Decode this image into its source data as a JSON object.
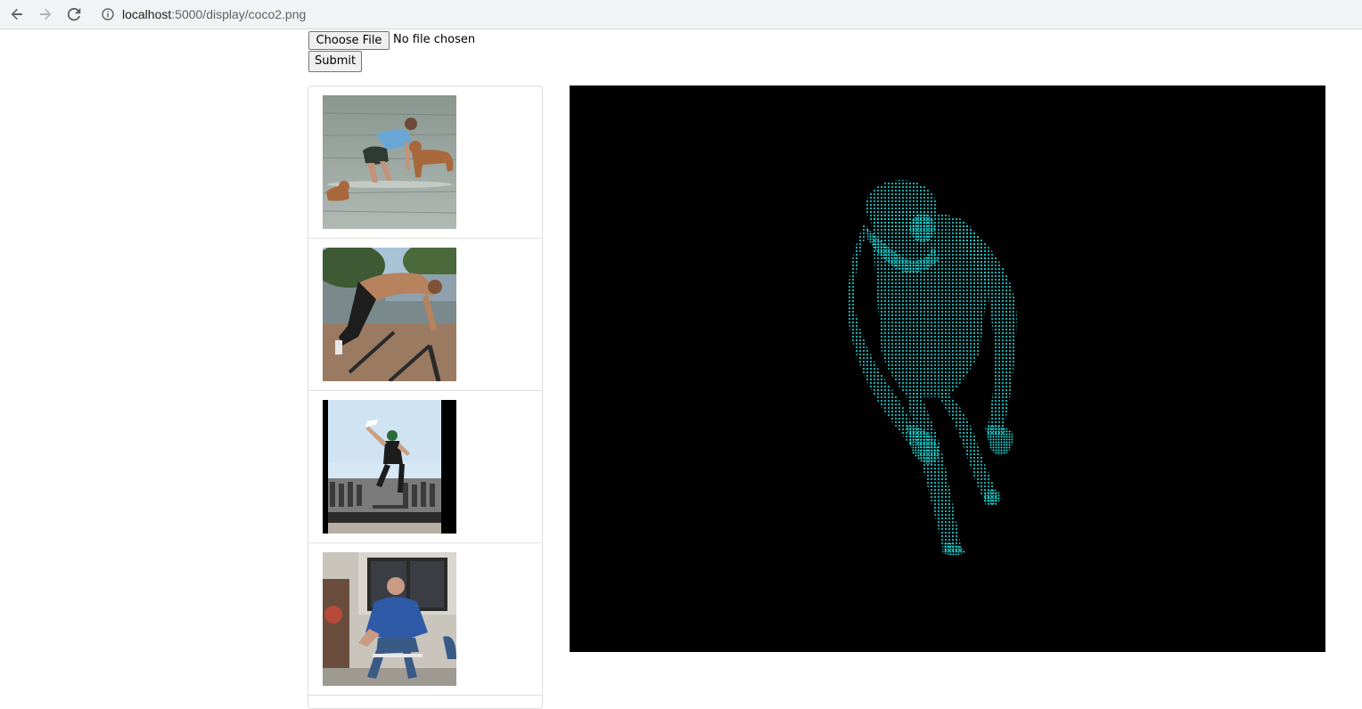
{
  "browser": {
    "url_host": "localhost",
    "url_path": ":5000/display/coco2.png",
    "back_icon": "arrow-left-icon",
    "forward_icon": "arrow-right-icon",
    "reload_icon": "reload-icon",
    "info_icon": "info-circle-icon"
  },
  "form": {
    "choose_file_label": "Choose File",
    "file_status": "No file chosen",
    "submit_label": "Submit"
  },
  "gallery": {
    "items": [
      {
        "scene": "woman with dogs in water"
      },
      {
        "scene": "man doing push-up on railing"
      },
      {
        "scene": "skateboarder doing trick"
      },
      {
        "scene": "man sitting on chair"
      }
    ]
  },
  "result": {
    "background": "#000000",
    "mesh_color": "#19e6e6"
  }
}
